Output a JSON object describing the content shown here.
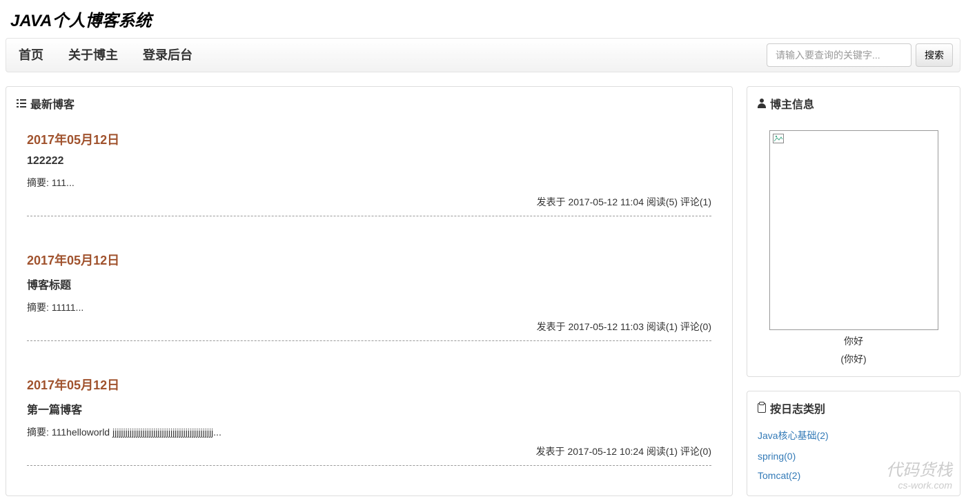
{
  "site": {
    "title": "JAVA个人博客系统"
  },
  "nav": {
    "items": [
      "首页",
      "关于博主",
      "登录后台"
    ],
    "search": {
      "placeholder": "请输入要查询的关键字...",
      "button": "搜索"
    }
  },
  "main": {
    "heading": "最新博客",
    "posts": [
      {
        "date": "2017年05月12日",
        "title": "122222",
        "summary": "摘要: 111...",
        "meta": "发表于 2017-05-12 11:04 阅读(5) 评论(1)"
      },
      {
        "date": "2017年05月12日",
        "title": "博客标题",
        "summary": "摘要: 11111...",
        "meta": "发表于 2017-05-12 11:03 阅读(1) 评论(0)"
      },
      {
        "date": "2017年05月12日",
        "title": "第一篇博客",
        "summary": "摘要: 111helloworld jjjjjjjjjjjjjjjjjjjjjjjjjjjjjjjjjjjjjjjjjjjjjjj...",
        "meta": "发表于 2017-05-12 10:24 阅读(1) 评论(0)"
      }
    ]
  },
  "sidebar": {
    "profile": {
      "heading": "博主信息",
      "name": "你好",
      "nickname": "(你好)"
    },
    "categories": {
      "heading": "按日志类别",
      "items": [
        "Java核心基础(2)",
        "spring(0)",
        "Tomcat(2)"
      ]
    }
  },
  "watermark": {
    "main": "代码货栈",
    "sub": "cs-work.com"
  }
}
